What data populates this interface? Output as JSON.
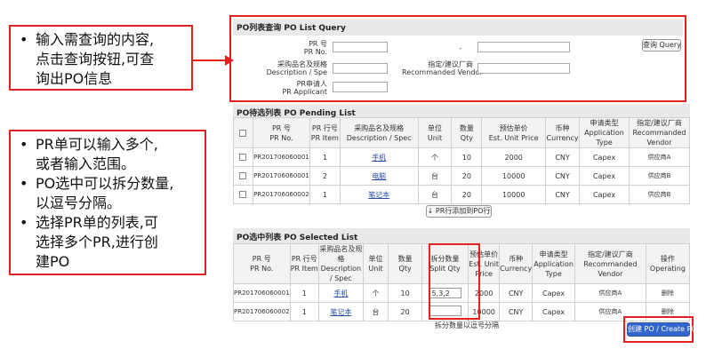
{
  "callout1": {
    "bullet": "•",
    "lines": [
      "输入需查询的内容,",
      "点击查询按钮,可查",
      "询出PO信息"
    ]
  },
  "callout2": {
    "bullet": "•",
    "items": [
      [
        "PR单可以输入多个,",
        "或者输入范围。"
      ],
      [
        "PO选中可以拆分数量,",
        "以逗号分隔。"
      ],
      [
        "选择PR单的列表,可",
        "选择多个PR,进行创",
        "建PO"
      ]
    ]
  },
  "query": {
    "title": "PO列表查询 PO List Query",
    "pr_label_cn": "PR 号",
    "pr_label_en": "PR No.",
    "dash": "-",
    "query_button": "查询 Query",
    "spec_label_cn": "采购品名及规格",
    "spec_label_en": "Description / Spe",
    "vendor_label_cn": "指定/建议厂商",
    "vendor_label_en": "Recommanded Vendor",
    "applicant_label_cn": "PR申请人",
    "applicant_label_en": "PR Applicant"
  },
  "pending": {
    "title": "PO待选列表 PO Pending List",
    "headers": [
      [
        "PR 号",
        "PR No."
      ],
      [
        "PR 行号",
        "PR Item"
      ],
      [
        "采购品名及规格",
        "Description / Spec"
      ],
      [
        "单位",
        "Unit"
      ],
      [
        "数量",
        "Qty"
      ],
      [
        "预估单价",
        "Est. Unit Price"
      ],
      [
        "币种",
        "Currency"
      ],
      [
        "申请类型",
        "Application Type"
      ],
      [
        "指定/建议厂商",
        "Recommanded Vendor"
      ]
    ],
    "rows": [
      {
        "pr": "PR201706060001",
        "item": "1",
        "desc": "手机",
        "unit": "个",
        "qty": "10",
        "price": "2000",
        "cur": "CNY",
        "type": "Capex",
        "vendor": "供应商A"
      },
      {
        "pr": "PR201706060001",
        "item": "2",
        "desc": "电脑",
        "unit": "台",
        "qty": "20",
        "price": "10000",
        "cur": "CNY",
        "type": "Capex",
        "vendor": "供应商B"
      },
      {
        "pr": "PR201706060002",
        "item": "1",
        "desc": "笔记本",
        "unit": "台",
        "qty": "20",
        "price": "10000",
        "cur": "CNY",
        "type": "Capex",
        "vendor": "供应商B"
      }
    ],
    "add_button": "↓ PR行添加到PO行"
  },
  "selected": {
    "title": "PO选中列表 PO Selected List",
    "headers": [
      [
        "PR 号",
        "PR No."
      ],
      [
        "PR 行号",
        "PR Item"
      ],
      [
        "采购品名及规格",
        "Description / Spec"
      ],
      [
        "单位",
        "Unit"
      ],
      [
        "数量",
        "Qty"
      ],
      [
        "拆分数量",
        "Split Qty"
      ],
      [
        "预估单价",
        "Est. Unit Price"
      ],
      [
        "币种",
        "Currency"
      ],
      [
        "申请类型",
        "Application Type"
      ],
      [
        "指定/建议厂商",
        "Recommanded Vendor"
      ],
      [
        "操作",
        "Operating"
      ]
    ],
    "rows": [
      {
        "pr": "PR201706060001",
        "item": "1",
        "desc": "手机",
        "unit": "个",
        "qty": "10",
        "split": "5,3,2",
        "price": "2000",
        "cur": "CNY",
        "type": "Capex",
        "vendor": "供应商A",
        "op": "删除"
      },
      {
        "pr": "PR201706060002",
        "item": "1",
        "desc": "笔记本",
        "unit": "台",
        "qty": "20",
        "split": "",
        "price": "10000",
        "cur": "CNY",
        "type": "Capex",
        "vendor": "供应商A",
        "op": "删除"
      }
    ],
    "split_note": "拆分数量以逗号分隔",
    "create_button": "创建 PO / Create PO"
  },
  "colors": {
    "accent_red": "#e0231c",
    "link_blue": "#2a4ea8",
    "create_blue": "#3366cc"
  }
}
